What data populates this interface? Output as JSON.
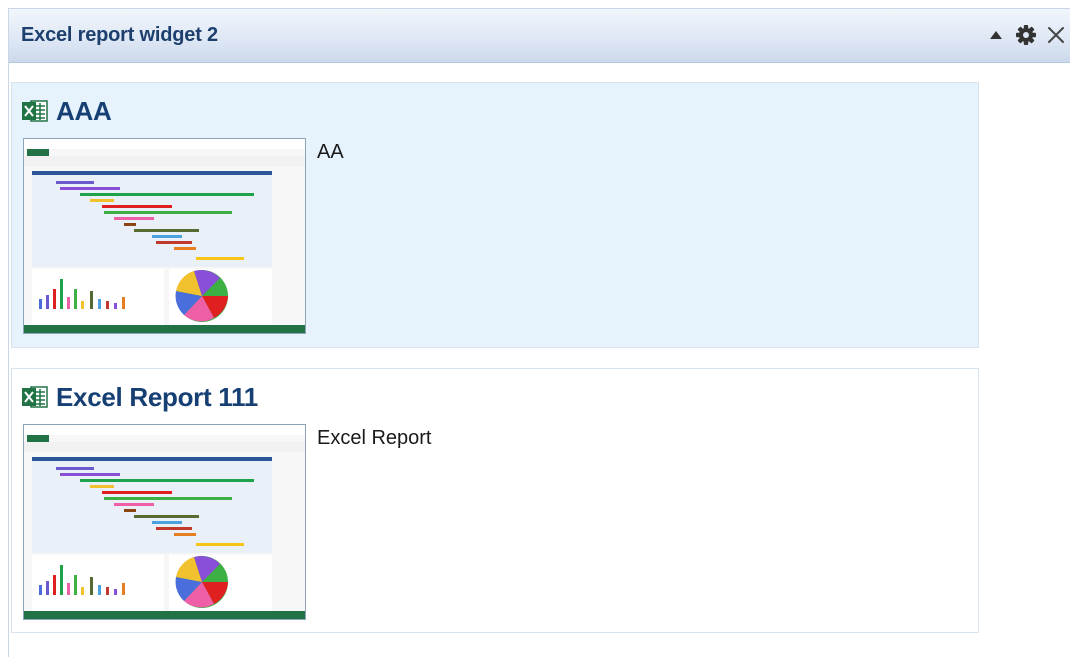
{
  "widget": {
    "title": "Excel report widget 2",
    "controls": [
      {
        "name": "collapse",
        "icon": "triangle-up-icon"
      },
      {
        "name": "settings",
        "icon": "gear-icon"
      },
      {
        "name": "close",
        "icon": "close-icon"
      }
    ]
  },
  "reports": [
    {
      "title": "AAA",
      "description": "AA",
      "icon": "excel-file-icon",
      "thumbnail": "spreadsheet-preview-thumbnail",
      "highlighted": true
    },
    {
      "title": "Excel Report 111",
      "description": "Excel Report",
      "icon": "excel-file-icon",
      "thumbnail": "spreadsheet-preview-thumbnail",
      "highlighted": false
    }
  ],
  "colors": {
    "header_text": "#1d3f6e",
    "title_text": "#163f73",
    "highlight_bg": "#e6f3fd",
    "excel_green": "#217346"
  }
}
